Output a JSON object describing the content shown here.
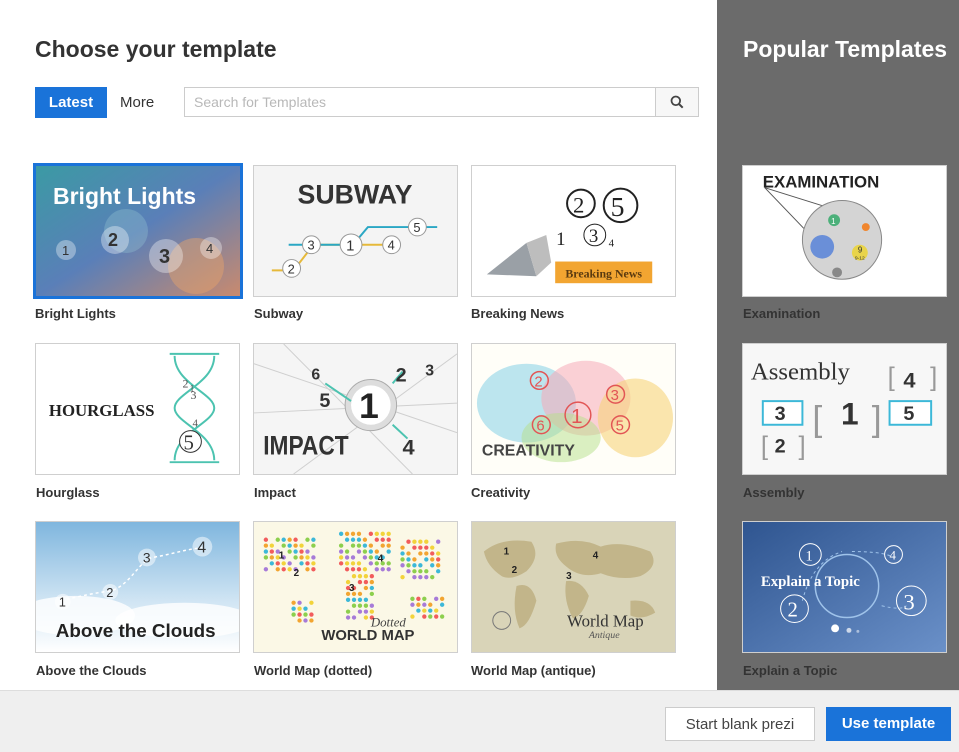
{
  "dialog": {
    "title": "Choose your template",
    "side_title": "Popular Templates"
  },
  "tabs": {
    "latest": "Latest",
    "more": "More"
  },
  "search": {
    "placeholder": "Search for Templates"
  },
  "templates": [
    {
      "label": "Bright Lights",
      "art": "Bright Lights",
      "nums": [
        "1",
        "2",
        "3",
        "4"
      ]
    },
    {
      "label": "Subway",
      "art": "SUBWAY",
      "nums": [
        "2",
        "3",
        "1",
        "4",
        "5"
      ]
    },
    {
      "label": "Breaking News",
      "art": "Breaking News",
      "nums": [
        "2",
        "5",
        "1",
        "3",
        "4"
      ]
    },
    {
      "label": "Hourglass",
      "art": "HOURGLASS",
      "nums": [
        "2",
        "3",
        "1",
        "4",
        "5"
      ]
    },
    {
      "label": "Impact",
      "art": "IMPACT",
      "nums": [
        "6",
        "2",
        "3",
        "5",
        "1",
        "4"
      ]
    },
    {
      "label": "Creativity",
      "art": "CREATIVITY",
      "nums": [
        "2",
        "3",
        "1",
        "6",
        "5"
      ]
    },
    {
      "label": "Above the Clouds",
      "art": "Above the Clouds",
      "nums": [
        "1",
        "2",
        "3",
        "4"
      ]
    },
    {
      "label": "World Map (dotted)",
      "art": "WORLD MAP",
      "art2": "Dotted",
      "nums": [
        "1",
        "2",
        "3",
        "4"
      ]
    },
    {
      "label": "World Map (antique)",
      "art": "World Map",
      "art2": "Antique",
      "nums": [
        "1",
        "2",
        "3",
        "4"
      ]
    }
  ],
  "popular": [
    {
      "label": "Examination",
      "art": "EXAMINATION",
      "nums": [
        "1",
        "9"
      ],
      "sub": "9-12"
    },
    {
      "label": "Assembly",
      "art": "Assembly",
      "nums": [
        "4",
        "3",
        "1",
        "5",
        "2"
      ]
    },
    {
      "label": "Explain a Topic",
      "art": "Explain a Topic",
      "nums": [
        "1",
        "4",
        "2",
        "3"
      ]
    }
  ],
  "buttons": {
    "blank": "Start blank prezi",
    "use": "Use template"
  },
  "icons": {
    "search": "search-icon"
  },
  "colors": {
    "accent": "#1a73d9",
    "side_panel": "#6b6b6b"
  }
}
